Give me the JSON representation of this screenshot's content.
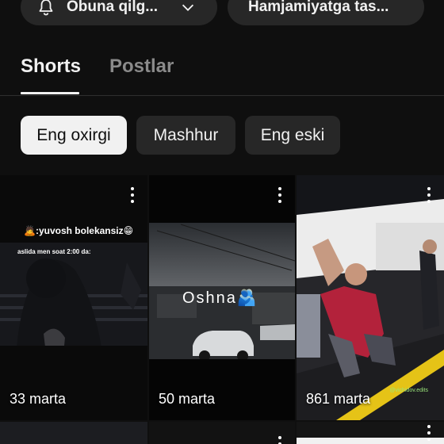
{
  "header": {
    "subscribe_label": "Obuna qilg...",
    "community_label": "Hamjamiyatga tas..."
  },
  "tabs": [
    {
      "label": "Shorts",
      "active": true
    },
    {
      "label": "Postlar",
      "active": false
    }
  ],
  "chips": [
    {
      "label": "Eng oxirgi",
      "selected": true
    },
    {
      "label": "Mashhur",
      "selected": false
    },
    {
      "label": "Eng eski",
      "selected": false
    }
  ],
  "shorts": [
    {
      "views": "33 marta",
      "caption": "🙇:yuvosh bolekansiz😁",
      "subcaption": "aslida men soat 2:00 da:"
    },
    {
      "views": "50 marta",
      "caption": "Oshna🫂"
    },
    {
      "views": "861 marta",
      "watermark": "@vichidov.edits"
    }
  ],
  "colors": {
    "background": "#0f0f0f",
    "chip_selected": "#f1f1f1",
    "chip_default": "#272727",
    "inactive_tab": "#8a8a8a"
  },
  "icons": [
    "bell-icon",
    "chevron-down-icon",
    "more-vert-icon"
  ]
}
